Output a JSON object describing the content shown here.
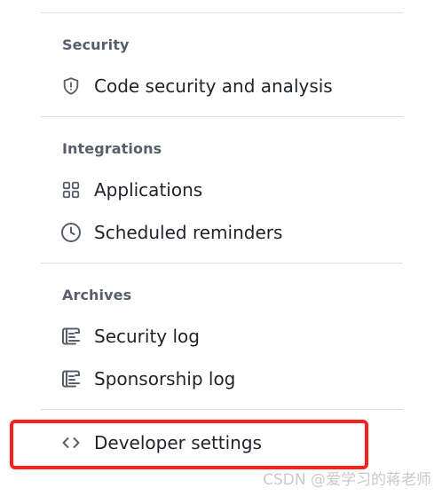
{
  "sections": {
    "security": {
      "heading": "Security",
      "items": [
        {
          "label": "Code security and analysis",
          "icon": "shield-icon"
        }
      ]
    },
    "integrations": {
      "heading": "Integrations",
      "items": [
        {
          "label": "Applications",
          "icon": "apps-grid-icon"
        },
        {
          "label": "Scheduled reminders",
          "icon": "clock-icon"
        }
      ]
    },
    "archives": {
      "heading": "Archives",
      "items": [
        {
          "label": "Security log",
          "icon": "log-icon"
        },
        {
          "label": "Sponsorship log",
          "icon": "log-icon"
        }
      ]
    }
  },
  "developer": {
    "label": "Developer settings",
    "icon": "code-icon"
  },
  "colors": {
    "highlight_border": "#ff1f1f",
    "text": "#1f2328",
    "muted": "#57606a",
    "divider": "#d8dee4"
  },
  "watermark": "CSDN @爱学习的蒋老师"
}
